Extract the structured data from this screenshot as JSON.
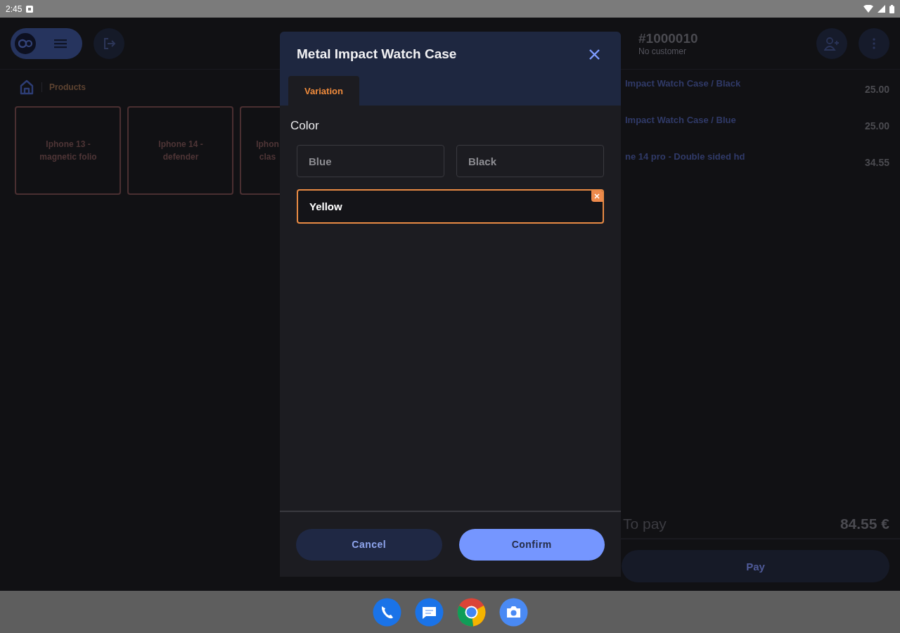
{
  "status_bar": {
    "time": "2:45"
  },
  "breadcrumb": {
    "current": "Products"
  },
  "products": [
    {
      "name": "Iphone 13 - magnetic folio"
    },
    {
      "name": "Iphone 14 - defender"
    },
    {
      "name": "Iphon clas"
    }
  ],
  "order": {
    "number": "#1000010",
    "customer": "No customer",
    "lines": [
      {
        "name": "Impact Watch Case / Black",
        "price": "25.00"
      },
      {
        "name": "Impact Watch Case / Blue",
        "price": "25.00"
      },
      {
        "name": "ne 14 pro - Double sided hd",
        "price": "34.55"
      }
    ],
    "total_label": "To pay",
    "total": "84.55 €",
    "pay_button": "Pay"
  },
  "dialog": {
    "title": "Metal Impact Watch Case",
    "tabs": [
      {
        "label": "Variation",
        "selected": true
      }
    ],
    "attribute": "Color",
    "options": [
      {
        "label": "Blue",
        "selected": false
      },
      {
        "label": "Black",
        "selected": false
      },
      {
        "label": "Yellow",
        "selected": true
      }
    ],
    "buttons": [
      {
        "label": "Cancel",
        "kind": "secondary"
      },
      {
        "label": "Confirm",
        "kind": "primary"
      }
    ]
  }
}
